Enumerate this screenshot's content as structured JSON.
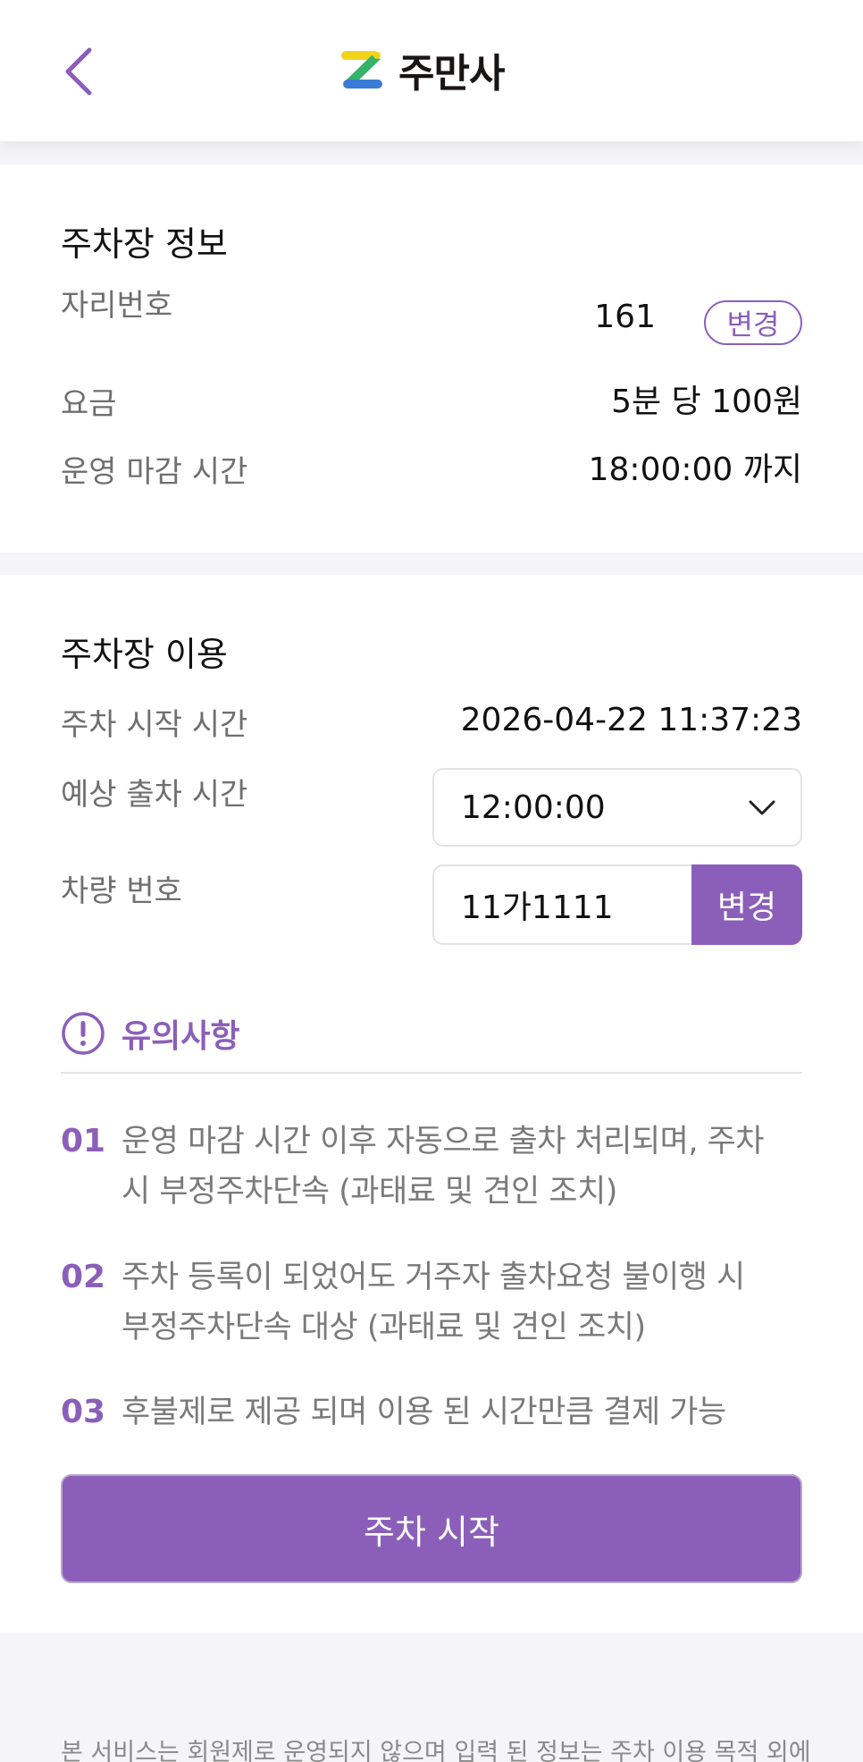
{
  "header": {
    "brand": "주만사",
    "colors": {
      "accent": "#8b5fb9",
      "logo_yellow": "#f1d319",
      "logo_blue": "#3a7bd5",
      "logo_green": "#35b36a"
    }
  },
  "lot_info": {
    "title": "주차장 정보",
    "spot_label": "자리번호",
    "spot_value": "161",
    "spot_change": "변경",
    "fee_label": "요금",
    "fee_value": "5분 당 100원",
    "close_label": "운영 마감 시간",
    "close_value": "18:00:00 까지"
  },
  "usage": {
    "title": "주차장 이용",
    "start_label": "주차 시작 시간",
    "start_value": "2026-04-22 11:37:23",
    "exit_label": "예상 출차 시간",
    "exit_value": "12:00:00",
    "car_label": "차량 번호",
    "car_value": "11가1111",
    "car_change": "변경"
  },
  "notice": {
    "title": "유의사항",
    "items": [
      {
        "num": "01",
        "line1": "운영 마감 시간 이후 자동으로 출차 처리되며, 주차",
        "line2": "시 부정주차단속 (과태료 및 견인 조치)"
      },
      {
        "num": "02",
        "line1": "주차 등록이 되었어도 거주자 출차요청 불이행 시",
        "line2": "부정주차단속 대상 (과태료 및 견인 조치)"
      },
      {
        "num": "03",
        "line1": "후불제로 제공 되며 이용 된 시간만큼 결제 가능",
        "line2": ""
      }
    ]
  },
  "start_button": "주차 시작",
  "footer_text": "본 서비스는 회원제로 운영되지 않으며 입력 된 정보는 주차 이용 목적 외에"
}
